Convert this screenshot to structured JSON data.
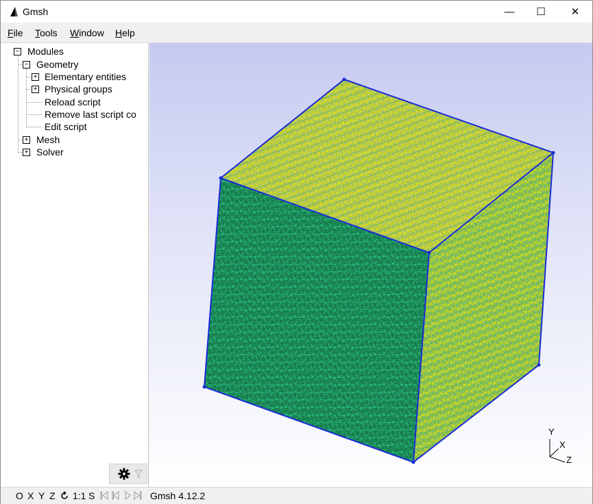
{
  "window": {
    "title": "Gmsh"
  },
  "titlebar_buttons": {
    "minimize": "—",
    "maximize": "☐",
    "close": "✕"
  },
  "menubar": {
    "items": [
      {
        "label": "File",
        "accel": "F",
        "rest": "ile"
      },
      {
        "label": "Tools",
        "accel": "T",
        "rest": "ools"
      },
      {
        "label": "Window",
        "accel": "W",
        "rest": "indow"
      },
      {
        "label": "Help",
        "accel": "H",
        "rest": "elp"
      }
    ]
  },
  "tree": {
    "root": "Modules",
    "geometry": "Geometry",
    "elementary_entities": "Elementary entities",
    "physical_groups": "Physical groups",
    "reload_script": "Reload script",
    "remove_last_script": "Remove last script co",
    "edit_script": "Edit script",
    "mesh": "Mesh",
    "solver": "Solver",
    "expanded_glyph": "−",
    "collapsed_glyph": "+"
  },
  "axes": {
    "y": "Y",
    "x": "X",
    "z": "Z"
  },
  "statusbar": {
    "x": "X",
    "o": "O",
    "y": "Y",
    "z": "Z",
    "scale": "1:1",
    "s": "S",
    "version": "Gmsh 4.12.2"
  },
  "colors": {
    "mesh_green": "#1a9a60",
    "mesh_yellow": "#e6e000",
    "edge_blue": "#1a2ad8",
    "viewport_top": "#c6caf0",
    "viewport_bottom": "#ffffff"
  }
}
